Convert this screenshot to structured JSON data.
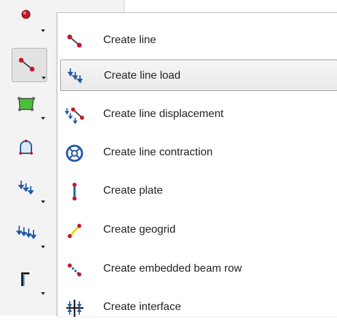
{
  "flyout_menu": {
    "items": [
      {
        "label": "Create line",
        "icon": "line-icon"
      },
      {
        "label": "Create line load",
        "icon": "line-load-icon"
      },
      {
        "label": "Create line displacement",
        "icon": "line-displacement-icon"
      },
      {
        "label": "Create line contraction",
        "icon": "line-contraction-icon"
      },
      {
        "label": "Create plate",
        "icon": "plate-icon"
      },
      {
        "label": "Create geogrid",
        "icon": "geogrid-icon"
      },
      {
        "label": "Create embedded beam row",
        "icon": "embedded-beam-row-icon"
      },
      {
        "label": "Create interface",
        "icon": "interface-icon"
      }
    ],
    "hovered_item": "Create line load"
  },
  "toolbar": {
    "buttons": [
      {
        "icon": "point-icon"
      },
      {
        "icon": "line-icon",
        "active": true
      },
      {
        "icon": "polygon-icon"
      },
      {
        "icon": "tunnel-icon"
      },
      {
        "icon": "point-load-icon"
      },
      {
        "icon": "distributed-load-icon"
      },
      {
        "icon": "well-icon"
      }
    ]
  },
  "colors": {
    "node_red": "#c3182a",
    "load_blue": "#1f5aa6",
    "polygon_green": "#4bbf3a",
    "geogrid_yellow": "#f2d400",
    "hover_border": "#9f9f9f"
  }
}
